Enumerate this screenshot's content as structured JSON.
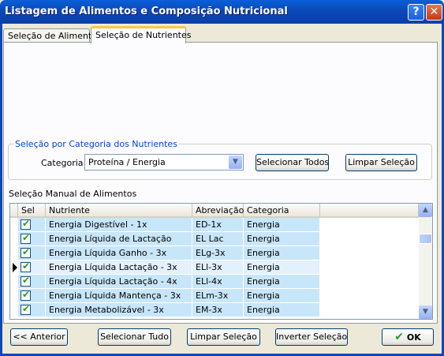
{
  "window": {
    "title": "Listagem de Alimentos e Composição Nutricional",
    "help_icon": "?",
    "close_icon": "✕"
  },
  "tabs": [
    {
      "label": "Seleção de Alimentos",
      "active": false
    },
    {
      "label": "Seleção de Nutrientes",
      "active": true
    }
  ],
  "category_group": {
    "title": "Seleção por Categoria dos Nutrientes",
    "category_label": "Categoria",
    "category_value": "Proteína / Energia",
    "select_all_label": "Selecionar Todos",
    "clear_label": "Limpar Seleção"
  },
  "manual_section": {
    "title": "Seleção Manual de Alimentos"
  },
  "grid": {
    "columns": [
      "Sel",
      "Nutriente",
      "Abreviação",
      "Categoria"
    ],
    "rows": [
      {
        "sel": true,
        "nutriente": "Energia Digestível - 1x",
        "abreviacao": "ED-1x",
        "categoria": "Energia",
        "current": false
      },
      {
        "sel": true,
        "nutriente": "Energia Líquida de Lactação",
        "abreviacao": "EL Lac",
        "categoria": "Energia",
        "current": false
      },
      {
        "sel": true,
        "nutriente": "Energia Líquida Ganho - 3x",
        "abreviacao": "ELg-3x",
        "categoria": "Energia",
        "current": false
      },
      {
        "sel": true,
        "nutriente": "Energia Líquida Lactação - 3x",
        "abreviacao": "ELl-3x",
        "categoria": "Energia",
        "current": true
      },
      {
        "sel": true,
        "nutriente": "Energia Líquida Lactação - 4x",
        "abreviacao": "ELl-4x",
        "categoria": "Energia",
        "current": false
      },
      {
        "sel": true,
        "nutriente": "Energia Líquida Mantença - 3x",
        "abreviacao": "ELm-3x",
        "categoria": "Energia",
        "current": false
      },
      {
        "sel": true,
        "nutriente": "Energia Metabolizável - 3x",
        "abreviacao": "EM-3x",
        "categoria": "Energia",
        "current": false
      }
    ]
  },
  "footer": {
    "previous_label": "<< Anterior",
    "select_all_label": "Selecionar Tudo",
    "clear_label": "Limpar Seleção",
    "invert_label": "Inverter Seleção",
    "ok_label": "OK"
  },
  "colors": {
    "title_bar": "#0b48b8",
    "row_fill": "#c8e6fa",
    "check_green": "#21a121",
    "group_title": "#0046d5"
  }
}
